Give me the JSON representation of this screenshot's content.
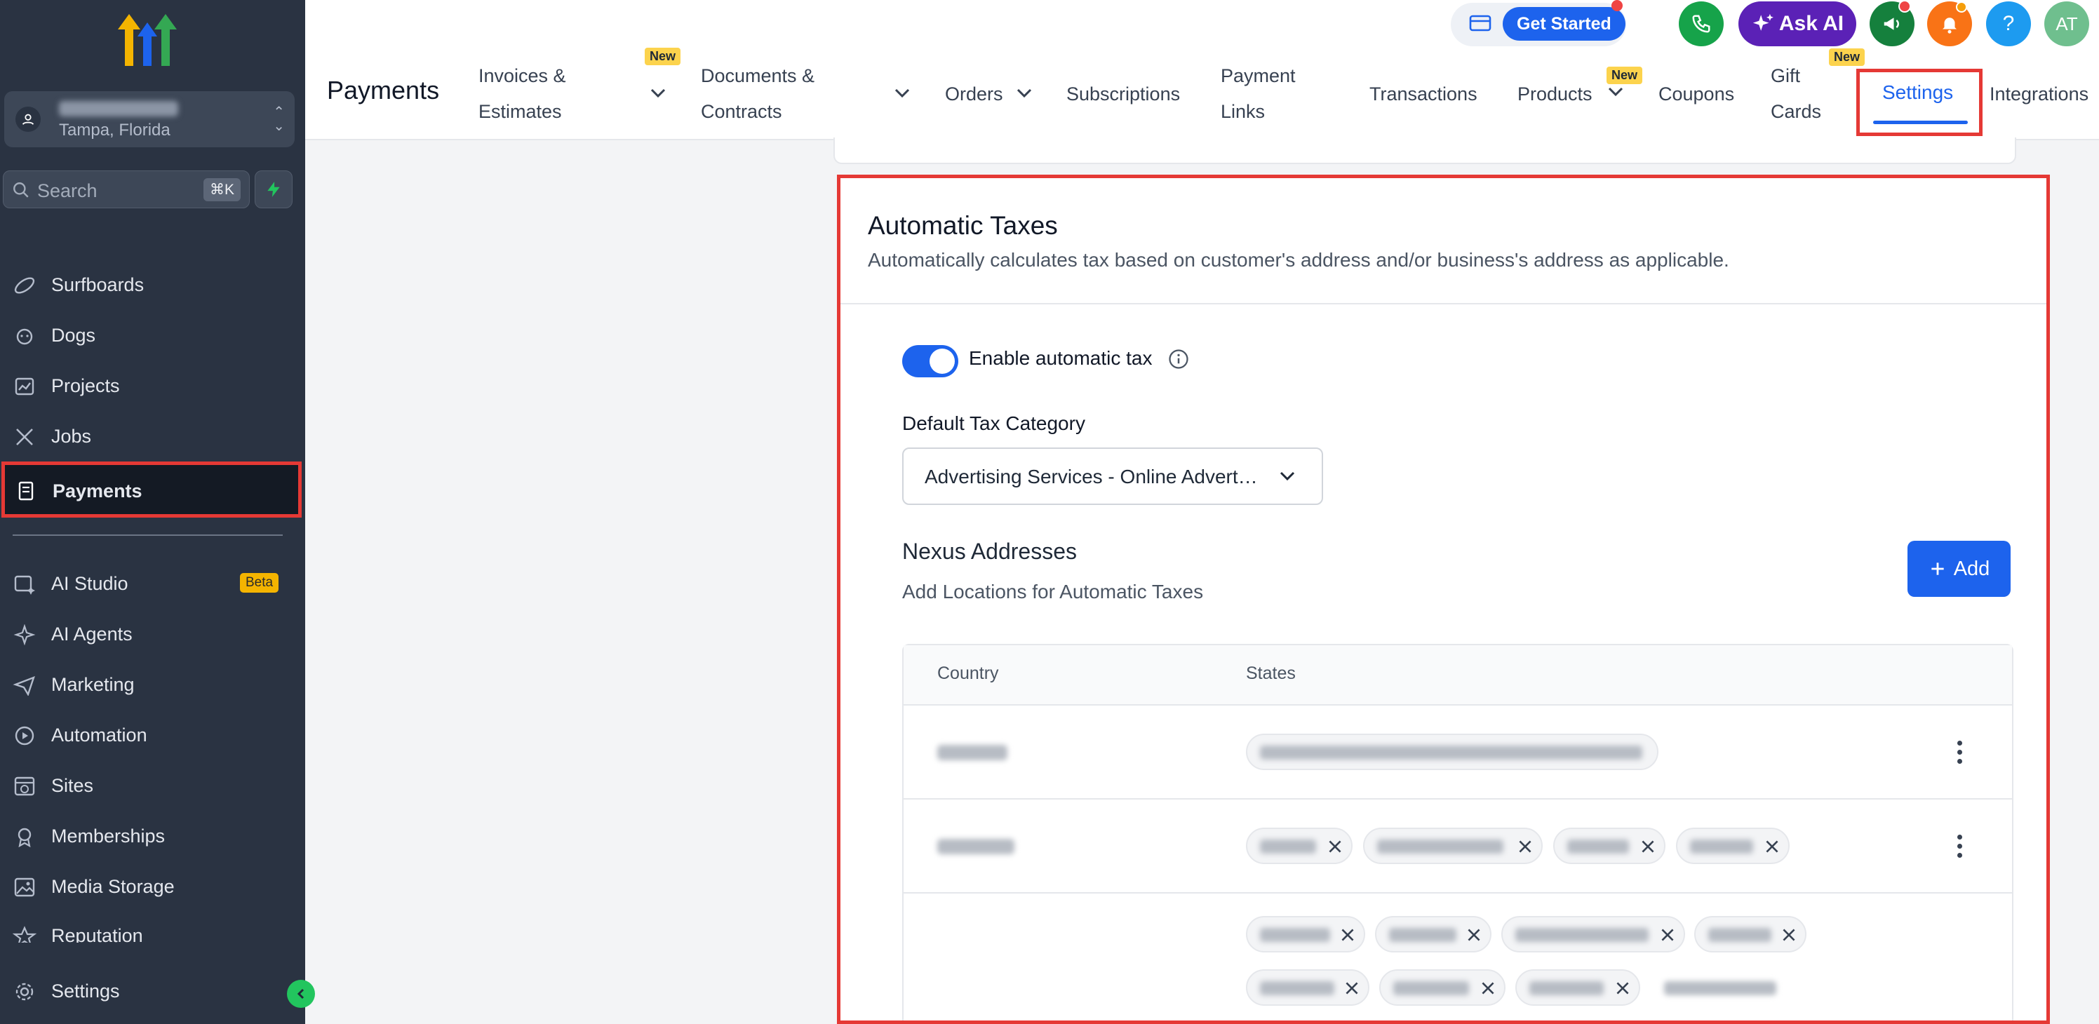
{
  "sidebar": {
    "location_city": "Tampa, Florida",
    "search_placeholder": "Search",
    "search_shortcut": "⌘K",
    "items": [
      {
        "label": "Surfboards",
        "icon": "surfboard-icon"
      },
      {
        "label": "Dogs",
        "icon": "dog-icon"
      },
      {
        "label": "Projects",
        "icon": "projects-icon"
      },
      {
        "label": "Jobs",
        "icon": "tools-icon"
      },
      {
        "label": "Payments",
        "icon": "receipt-icon",
        "active": true
      },
      {
        "label": "AI Studio",
        "icon": "ai-studio-icon",
        "badge": "Beta"
      },
      {
        "label": "AI Agents",
        "icon": "sparkle-icon"
      },
      {
        "label": "Marketing",
        "icon": "send-icon"
      },
      {
        "label": "Automation",
        "icon": "play-circle-icon"
      },
      {
        "label": "Sites",
        "icon": "globe-window-icon"
      },
      {
        "label": "Memberships",
        "icon": "award-icon"
      },
      {
        "label": "Media Storage",
        "icon": "image-icon"
      },
      {
        "label": "Reputation",
        "icon": "star-icon"
      }
    ],
    "settings_label": "Settings"
  },
  "header": {
    "get_started_label": "Get Started",
    "ask_ai_label": "Ask AI",
    "avatar_initials": "AT",
    "help_symbol": "?",
    "page_title": "Payments",
    "tabs": [
      {
        "label_line1": "Invoices &",
        "label_line2": "Estimates",
        "badge": "New",
        "dropdown": true
      },
      {
        "label_line1": "Documents &",
        "label_line2": "Contracts",
        "dropdown": true
      },
      {
        "label": "Orders",
        "dropdown": true
      },
      {
        "label": "Subscriptions"
      },
      {
        "label_line1": "Payment",
        "label_line2": "Links"
      },
      {
        "label": "Transactions"
      },
      {
        "label": "Products",
        "badge": "New",
        "dropdown": true
      },
      {
        "label": "Coupons"
      },
      {
        "label_line1": "Gift",
        "label_line2": "Cards",
        "badge": "New"
      },
      {
        "label": "Settings",
        "active": true
      },
      {
        "label": "Integrations"
      }
    ]
  },
  "automatic_taxes": {
    "title": "Automatic Taxes",
    "description": "Automatically calculates tax based on customer's address and/or business's address as applicable.",
    "enable_label": "Enable automatic tax",
    "enabled": true,
    "default_tax_category_label": "Default Tax Category",
    "default_tax_category_value": "Advertising Services - Online Advertising",
    "nexus_title": "Nexus Addresses",
    "nexus_subtitle": "Add Locations for Automatic Taxes",
    "add_button_label": "Add",
    "table_headers": [
      "Country",
      "States"
    ]
  },
  "colors": {
    "sidebar_bg": "#2a3342",
    "primary": "#1d63ed",
    "highlight_border": "#e53935",
    "ask_ai": "#5b21b6"
  }
}
